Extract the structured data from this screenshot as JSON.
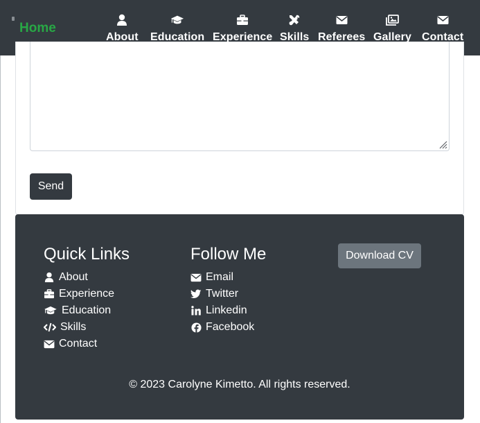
{
  "navbar": {
    "brand": "Home",
    "items": [
      {
        "label": "About",
        "icon": "user-icon"
      },
      {
        "label": "Education",
        "icon": "graduation-cap-icon"
      },
      {
        "label": "Experience",
        "icon": "briefcase-icon"
      },
      {
        "label": "Skills",
        "icon": "tools-icon"
      },
      {
        "label": "Referees",
        "icon": "envelope-icon"
      },
      {
        "label": "Gallery",
        "icon": "images-icon"
      },
      {
        "label": "Contact",
        "icon": "envelope-icon"
      }
    ]
  },
  "contact_form": {
    "message_value": "",
    "send_label": "Send"
  },
  "footer": {
    "quick_links": {
      "title": "Quick Links",
      "items": [
        {
          "label": "About",
          "icon": "user-icon"
        },
        {
          "label": "Experience",
          "icon": "briefcase-icon"
        },
        {
          "label": "Education",
          "icon": "graduation-cap-icon"
        },
        {
          "label": "Skills",
          "icon": "code-icon"
        },
        {
          "label": "Contact",
          "icon": "envelope-icon"
        }
      ]
    },
    "follow_me": {
      "title": "Follow Me",
      "items": [
        {
          "label": "Email",
          "icon": "envelope-icon"
        },
        {
          "label": "Twitter",
          "icon": "twitter-icon"
        },
        {
          "label": "Linkedin",
          "icon": "linkedin-icon"
        },
        {
          "label": "Facebook",
          "icon": "facebook-icon"
        }
      ]
    },
    "download_label": "Download CV",
    "copyright": "© 2023 Carolyne Kimetto. All rights reserved."
  },
  "colors": {
    "navbar_bg": "#343a40",
    "brand": "#28a745",
    "footer_bg": "#343a40",
    "download_btn": "#6c757d"
  }
}
